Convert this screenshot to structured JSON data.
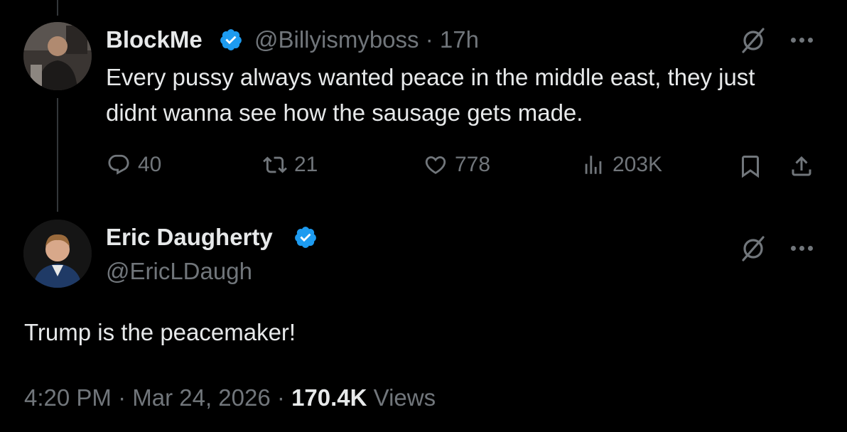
{
  "tweet1": {
    "name": "BlockMe",
    "handle": "@Billyismyboss",
    "separator": "·",
    "time": "17h",
    "text": "Every pussy always wanted peace in the middle east, they just didnt wanna see how the sausage gets made.",
    "replies": "40",
    "retweets": "21",
    "likes": "778",
    "views": "203K"
  },
  "tweet2": {
    "name": "Eric Daugherty",
    "handle": "@EricLDaugh",
    "text": "Trump is the peacemaker!",
    "time": "4:20 PM",
    "sep1": "·",
    "date": "Mar 24, 2026",
    "sep2": "·",
    "views_count": "170.4K",
    "views_label": "Views"
  },
  "colors": {
    "background": "#000000",
    "text": "#e7e9ea",
    "muted": "#71767b",
    "verified": "#1d9bf0",
    "thread_line": "#333639"
  }
}
